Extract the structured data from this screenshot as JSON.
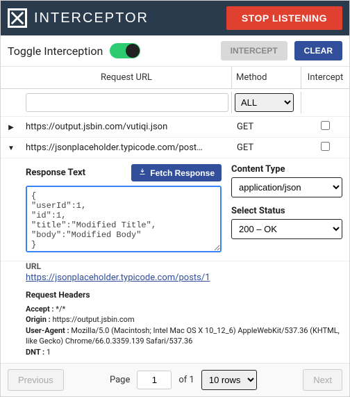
{
  "header": {
    "app_name": "INTERCEPTOR",
    "stop_label": "STOP LISTENING"
  },
  "toolbar": {
    "toggle_label": "Toggle Interception",
    "toggle_on": true,
    "intercept_label": "INTERCEPT",
    "clear_label": "CLEAR"
  },
  "columns": {
    "url": "Request URL",
    "method": "Method",
    "intercept": "Intercept"
  },
  "filters": {
    "url_value": "",
    "method_selected": "ALL"
  },
  "requests": [
    {
      "expanded": false,
      "url": "https://output.jsbin.com/vutiqi.json",
      "method": "GET",
      "intercept": false
    },
    {
      "expanded": true,
      "url": "https://jsonplaceholder.typicode.com/post…",
      "method": "GET",
      "intercept": false
    }
  ],
  "detail": {
    "response_label": "Response Text",
    "fetch_label": "Fetch Response",
    "response_body": "{\n\"userId\":1,\n\"id\":1,\n\"title\":\"Modified Title\",\n\"body\":\"Modified Body\"\n}",
    "content_type_label": "Content Type",
    "content_type_value": "application/json",
    "status_label": "Select Status",
    "status_value": "200 – OK",
    "url_label": "URL",
    "full_url": "https://jsonplaceholder.typicode.com/posts/1",
    "headers_title": "Request Headers",
    "headers": [
      {
        "name": "Accept",
        "value": "*/*"
      },
      {
        "name": "Origin",
        "value": "https://output.jsbin.com"
      },
      {
        "name": "User-Agent",
        "value": "Mozilla/5.0 (Macintosh; Intel Mac OS X 10_12_6) AppleWebKit/537.36 (KHTML, like Gecko) Chrome/66.0.3359.139 Safari/537.36"
      },
      {
        "name": "DNT",
        "value": "1"
      }
    ]
  },
  "pager": {
    "prev": "Previous",
    "page_label": "Page",
    "page_value": "1",
    "of_label": "of 1",
    "rows_value": "10 rows",
    "next": "Next"
  }
}
